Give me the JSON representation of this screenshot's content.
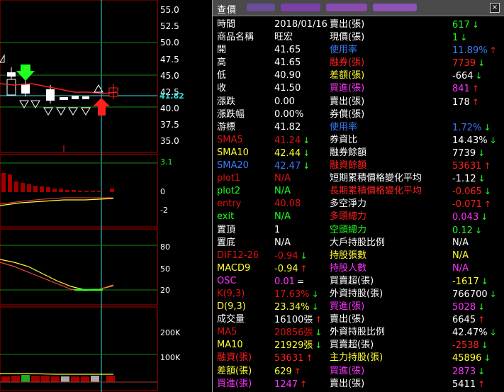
{
  "colors": {
    "white": "#ffffff",
    "yellow": "#ffff33",
    "red": "#ff2020",
    "green": "#20ff20",
    "blue": "#3a7bff",
    "magenta": "#ff33ff",
    "darkred": "#e01010",
    "cyan": "#33dddd"
  },
  "panel": {
    "title": "查價",
    "close": "×"
  },
  "chart_data": [
    {
      "type": "line",
      "title": "",
      "price_axis": {
        "labels": [
          "55.0",
          "52.5",
          "50.0",
          "47.5",
          "45.0",
          "42.5",
          "40.0",
          "37.5",
          "35.0"
        ]
      },
      "current_price": "41.82"
    },
    {
      "type": "bar",
      "title": "",
      "axis": {
        "labels": [
          "3.1",
          "0",
          "-2"
        ]
      }
    },
    {
      "type": "line",
      "title": "",
      "axis": {
        "labels": [
          "80",
          "50",
          "20"
        ]
      }
    },
    {
      "type": "bar",
      "title": "",
      "axis": {
        "labels": [
          "200K",
          "100K"
        ]
      }
    }
  ],
  "rows": [
    {
      "l": "時間",
      "lc": "white",
      "v": "2018/01/16",
      "vc": "white",
      "r": "賣出(張)",
      "rc": "white",
      "rv": "617",
      "rvc": "green",
      "ra": "down"
    },
    {
      "l": "商品名稱",
      "lc": "white",
      "v": "旺宏",
      "vc": "white",
      "r": "現價(張)",
      "rc": "white",
      "rv": "1",
      "rvc": "green",
      "ra": "down"
    },
    {
      "l": "開",
      "lc": "white",
      "v": "41.65",
      "vc": "white",
      "r": "使用率",
      "rc": "blue",
      "rv": "11.89%",
      "rvc": "blue",
      "ra": "up"
    },
    {
      "l": "高",
      "lc": "white",
      "v": "41.65",
      "vc": "white",
      "r": "融券(張)",
      "rc": "red",
      "rv": "7739",
      "rvc": "red",
      "ra": "down"
    },
    {
      "l": "低",
      "lc": "white",
      "v": "40.90",
      "vc": "white",
      "r": "差額(張)",
      "rc": "yellow",
      "rv": "-664",
      "rvc": "white",
      "ra": "down"
    },
    {
      "l": "收",
      "lc": "white",
      "v": "41.50",
      "vc": "white",
      "r": "買進(張)",
      "rc": "magenta",
      "rv": "841",
      "rvc": "magenta",
      "ra": "up"
    },
    {
      "l": "漲跌",
      "lc": "white",
      "v": "0.00",
      "vc": "white",
      "r": "賣出(張)",
      "rc": "white",
      "rv": "178",
      "rvc": "white",
      "ra": "up"
    },
    {
      "l": "漲跌幅",
      "lc": "white",
      "v": "0.00%",
      "vc": "white",
      "r": "券償(張)",
      "rc": "white",
      "rv": "",
      "rvc": "white",
      "ra": ""
    },
    {
      "l": "游標",
      "lc": "white",
      "v": "41.82",
      "vc": "white",
      "r": "使用率",
      "rc": "blue",
      "rv": "1.72%",
      "rvc": "blue",
      "ra": "down"
    },
    {
      "l": "SMA5",
      "lc": "darkred",
      "v": "41.24",
      "vc": "darkred",
      "va": "down",
      "r": "券資比",
      "rc": "white",
      "rv": "14.43%",
      "rvc": "white",
      "ra": "down"
    },
    {
      "l": "SMA10",
      "lc": "yellow",
      "v": "42.44",
      "vc": "yellow",
      "va": "down",
      "r": "融券餘額",
      "rc": "white",
      "rv": "7739",
      "rvc": "white",
      "ra": "down"
    },
    {
      "l": "SMA20",
      "lc": "blue",
      "v": "42.47",
      "vc": "blue",
      "va": "down",
      "r": "融資餘額",
      "rc": "red",
      "rv": "53631",
      "rvc": "red",
      "ra": "up"
    },
    {
      "l": "plot1",
      "lc": "darkred",
      "v": "N/A",
      "vc": "darkred",
      "r": "短期累積價格變化平均",
      "rc": "white",
      "rv": "-1.12",
      "rvc": "white",
      "ra": "down"
    },
    {
      "l": "plot2",
      "lc": "green",
      "v": "N/A",
      "vc": "green",
      "r": "長期累積價格變化平均",
      "rc": "red",
      "rv": "-0.065",
      "rvc": "red",
      "ra": "down"
    },
    {
      "l": "entry",
      "lc": "darkred",
      "v": "40.08",
      "vc": "darkred",
      "r": "多空淨力",
      "rc": "white",
      "rv": "-0.071",
      "rvc": "red",
      "ra": "up"
    },
    {
      "l": "exit",
      "lc": "green",
      "v": "N/A",
      "vc": "green",
      "r": "多頭總力",
      "rc": "red",
      "rv": "0.043",
      "rvc": "magenta",
      "ra": "down"
    },
    {
      "l": "置頂",
      "lc": "white",
      "v": "1",
      "vc": "white",
      "r": "空頭總力",
      "rc": "green",
      "rv": "0.12",
      "rvc": "green",
      "ra": "down"
    },
    {
      "l": "置底",
      "lc": "white",
      "v": "N/A",
      "vc": "white",
      "r": "大戶持股比例",
      "rc": "white",
      "rv": "N/A",
      "rvc": "white",
      "ra": ""
    },
    {
      "l": "DIF12-26",
      "lc": "darkred",
      "v": "-0.94",
      "vc": "darkred",
      "va": "down",
      "r": "持股張數",
      "rc": "yellow",
      "rv": "N/A",
      "rvc": "yellow",
      "ra": ""
    },
    {
      "l": "MACD9",
      "lc": "yellow",
      "v": "-0.94",
      "vc": "yellow",
      "va": "up",
      "r": "持股人數",
      "rc": "magenta",
      "rv": "N/A",
      "rvc": "magenta",
      "ra": ""
    },
    {
      "l": "OSC",
      "lc": "magenta",
      "v": "0.01",
      "vc": "magenta",
      "va": "=",
      "r": "買賣超(張)",
      "rc": "white",
      "rv": "-1617",
      "rvc": "yellow",
      "ra": "down"
    },
    {
      "l": "K(9,3)",
      "lc": "darkred",
      "v": "17.63%",
      "vc": "darkred",
      "va": "down",
      "r": "外資持股(張)",
      "rc": "white",
      "rv": "766700",
      "rvc": "white",
      "ra": "down"
    },
    {
      "l": "D(9,3)",
      "lc": "yellow",
      "v": "23.34%",
      "vc": "yellow",
      "va": "down",
      "r": "買進(張)",
      "rc": "magenta",
      "rv": "5028",
      "rvc": "magenta",
      "ra": "down"
    },
    {
      "l": "成交量",
      "lc": "white",
      "v": "16100張",
      "vc": "white",
      "va": "up",
      "r": "賣出(張)",
      "rc": "white",
      "rv": "6645",
      "rvc": "white",
      "ra": "up"
    },
    {
      "l": "MA5",
      "lc": "darkred",
      "v": "20856張",
      "vc": "darkred",
      "va": "down",
      "r": "外資持股比例",
      "rc": "white",
      "rv": "42.47%",
      "rvc": "white",
      "ra": "down"
    },
    {
      "l": "MA10",
      "lc": "yellow",
      "v": "21929張",
      "vc": "yellow",
      "va": "down",
      "r": "買賣超(張)",
      "rc": "white",
      "rv": "-2538",
      "rvc": "red",
      "ra": "down"
    },
    {
      "l": "融資(張)",
      "lc": "red",
      "v": "53631",
      "vc": "red",
      "va": "up",
      "r": "主力持股(張)",
      "rc": "yellow",
      "rv": "45896",
      "rvc": "yellow",
      "ra": "down"
    },
    {
      "l": "差額(張)",
      "lc": "yellow",
      "v": "629",
      "vc": "yellow",
      "va": "up",
      "r": "買進(張)",
      "rc": "magenta",
      "rv": "2873",
      "rvc": "magenta",
      "ra": "down"
    },
    {
      "l": "買進(張)",
      "lc": "magenta",
      "v": "1247",
      "vc": "magenta",
      "va": "up",
      "r": "賣出(張)",
      "rc": "white",
      "rv": "5411",
      "rvc": "white",
      "ra": "up"
    }
  ]
}
